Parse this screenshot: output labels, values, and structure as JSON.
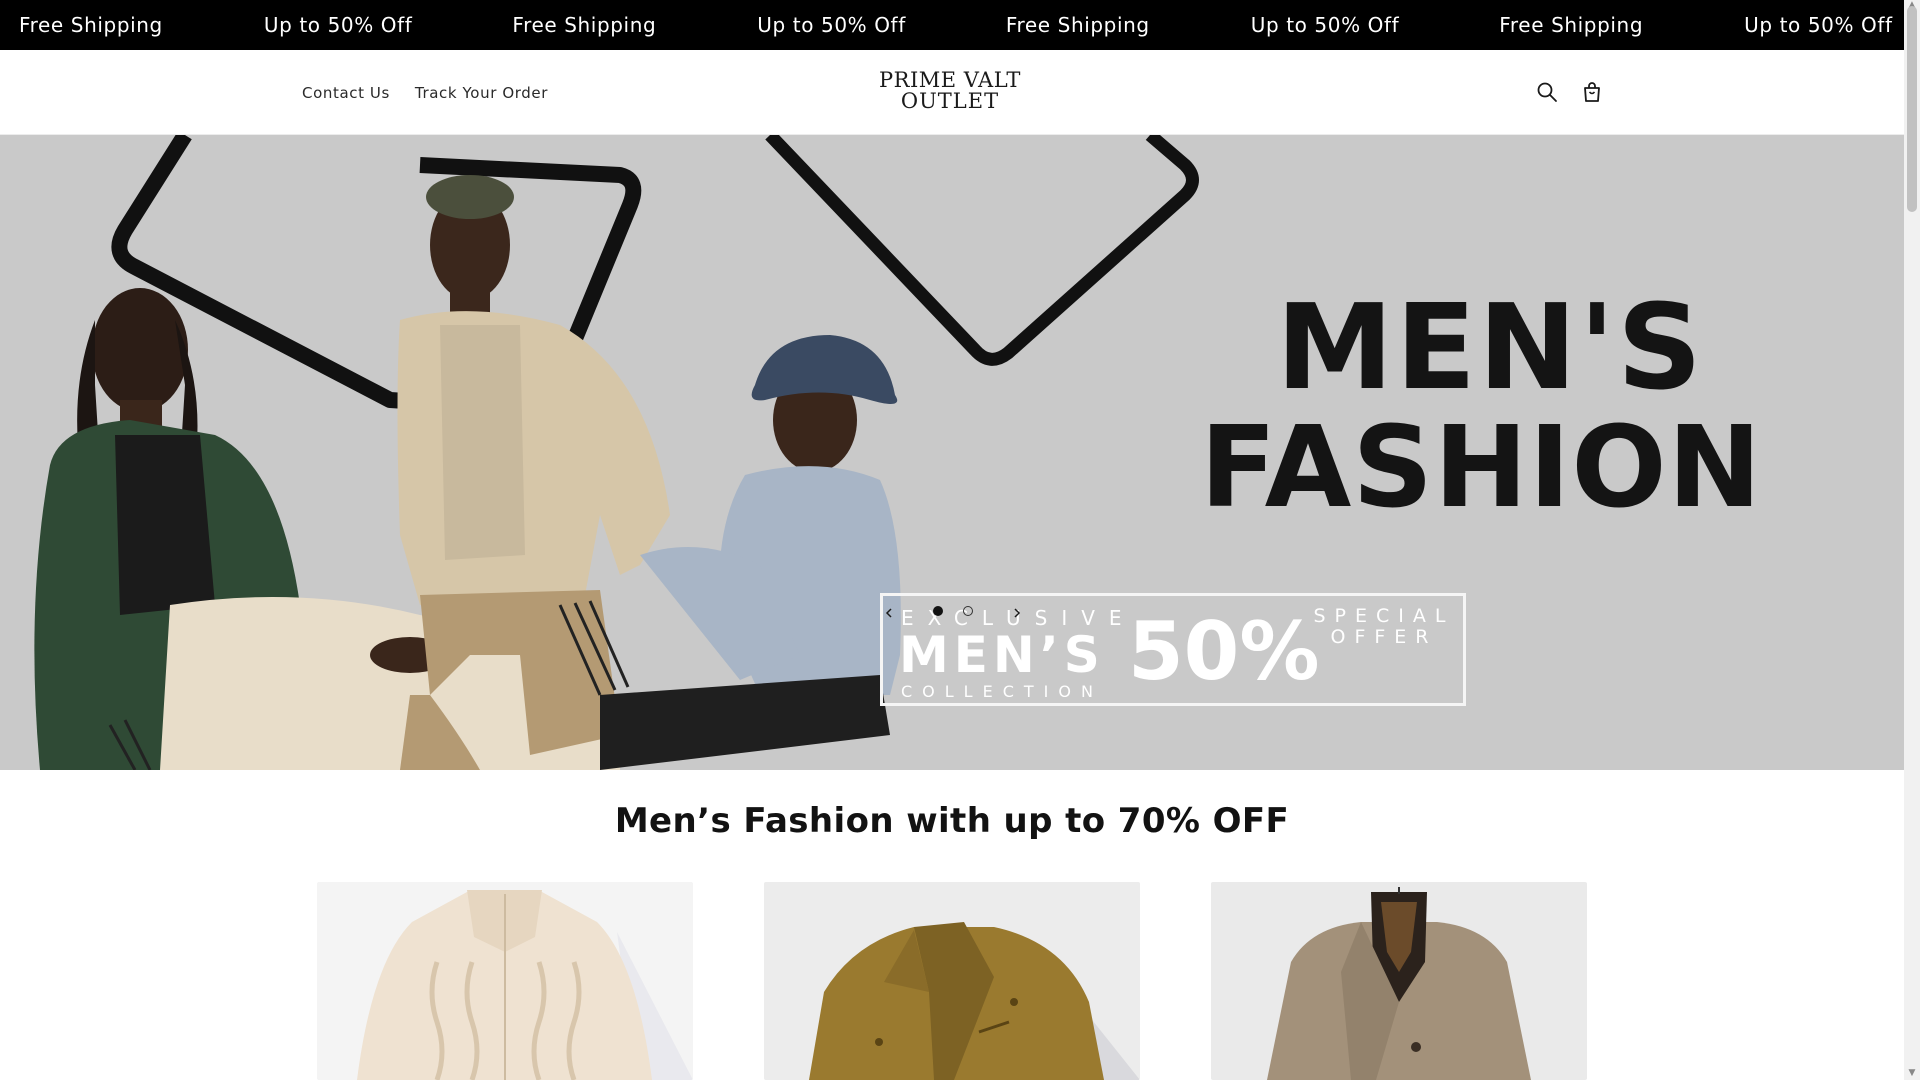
{
  "announcement": {
    "messages": [
      "Free Shipping",
      "Up to 50% Off",
      "Free Shipping",
      "Up to 50% Off",
      "Free Shipping",
      "Up to 50% Off",
      "Free Shipping",
      "Up to 50% Off",
      "Free Shipping"
    ]
  },
  "header": {
    "nav": [
      {
        "label": "Contact Us"
      },
      {
        "label": "Track Your Order"
      }
    ],
    "logo": {
      "line1": "PRIME VALT",
      "line2": "OUTLET"
    },
    "icons": [
      "search-icon",
      "cart-icon"
    ]
  },
  "hero": {
    "title_line1": "MEN'S",
    "title_line2": "FASHION",
    "promo": {
      "exclusive": "EXCLUSIVE",
      "mens": "MEN’S",
      "collection": "COLLECTION",
      "percent": "50%",
      "special": "SPECIAL",
      "offer": "OFFER"
    },
    "slides_total": 2,
    "active_slide": 1,
    "background_color": "#c9c9c9"
  },
  "section": {
    "title": "Men’s Fashion with up to 70% OFF"
  },
  "colors": {
    "announcement_bg": "#000000",
    "text": "#121212",
    "accent": "#000000"
  }
}
